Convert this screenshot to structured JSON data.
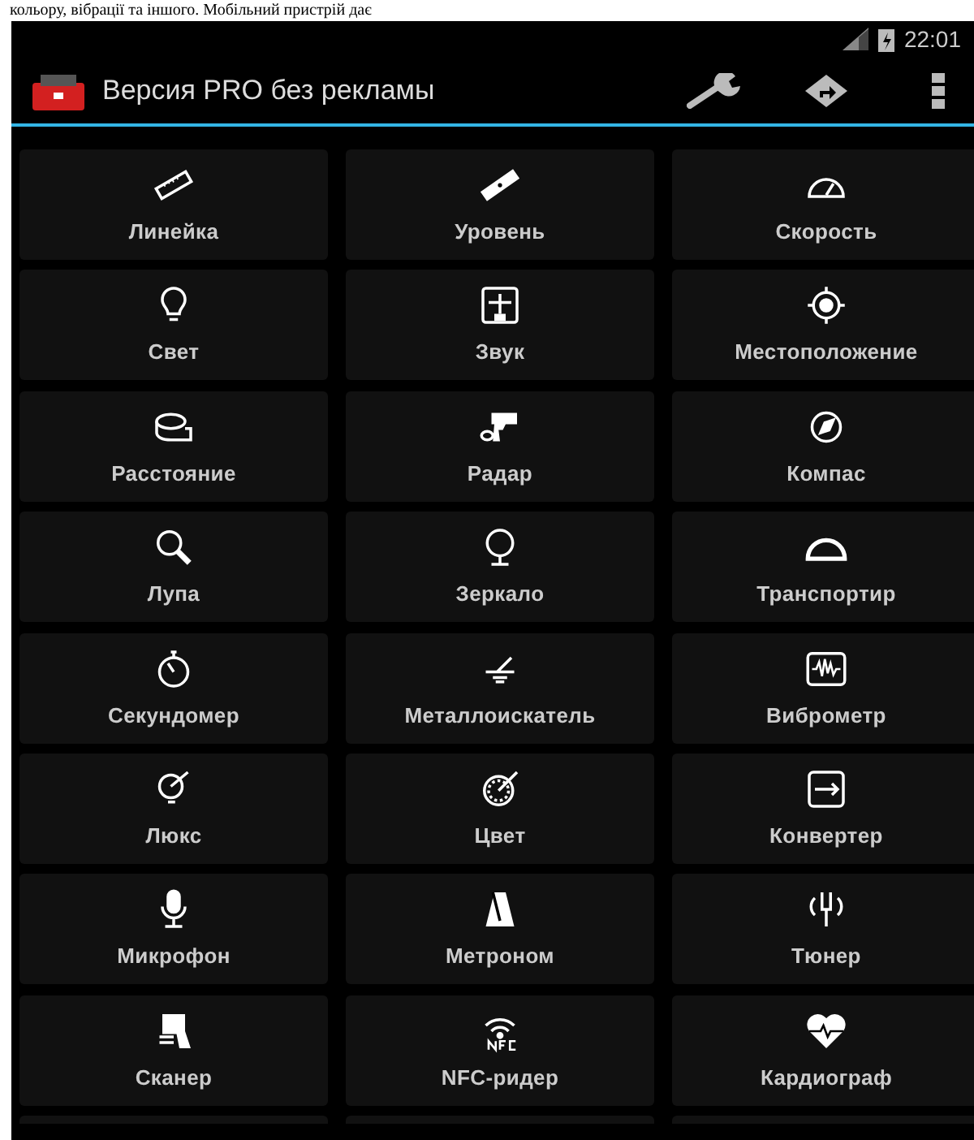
{
  "page_text": "кольору, вібрації та іншого. Мобільний пристрій дає",
  "status_bar": {
    "time": "22:01"
  },
  "action_bar": {
    "title": "Версия PRO без рекламы"
  },
  "tools": [
    {
      "label": "Линейка"
    },
    {
      "label": "Уровень"
    },
    {
      "label": "Скорость"
    },
    {
      "label": "Свет"
    },
    {
      "label": "Звук"
    },
    {
      "label": "Местоположение"
    },
    {
      "label": "Расстояние"
    },
    {
      "label": "Радар"
    },
    {
      "label": "Компас"
    },
    {
      "label": "Лупа"
    },
    {
      "label": "Зеркало"
    },
    {
      "label": "Транспортир"
    },
    {
      "label": "Секундомер"
    },
    {
      "label": "Металлоискатель"
    },
    {
      "label": "Виброметр"
    },
    {
      "label": "Люкс"
    },
    {
      "label": "Цвет"
    },
    {
      "label": "Конвертер"
    },
    {
      "label": "Микрофон"
    },
    {
      "label": "Метроном"
    },
    {
      "label": "Тюнер"
    },
    {
      "label": "Сканер"
    },
    {
      "label": "NFC-ридер"
    },
    {
      "label": "Кардиограф"
    }
  ]
}
